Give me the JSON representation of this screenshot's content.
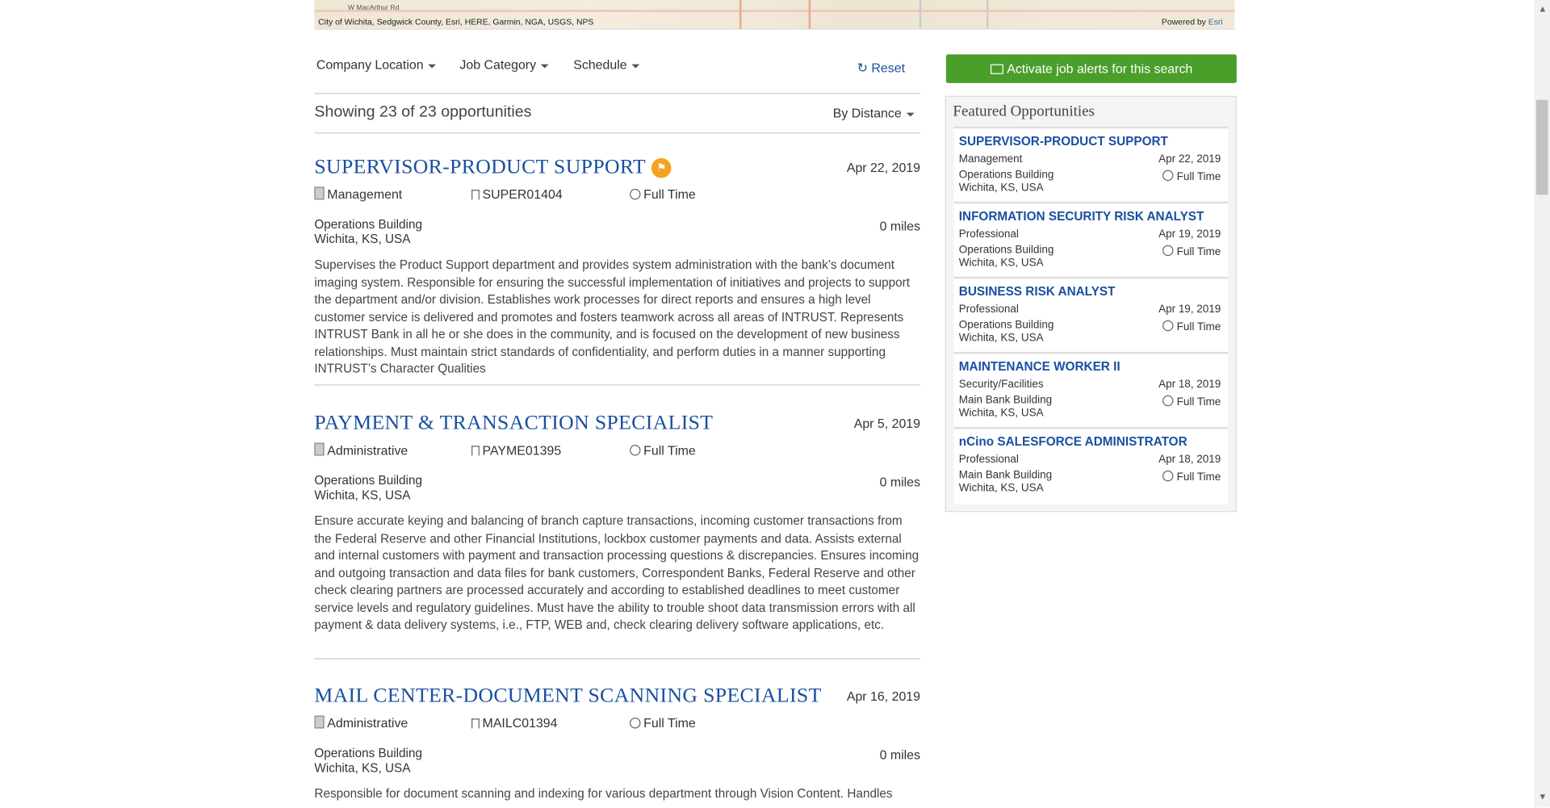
{
  "map": {
    "street_label": "W MacArthur Rd",
    "attribution": "City of Wichita, Sedgwick County, Esri, HERE, Garmin, NGA, USGS, NPS",
    "powered_prefix": "Powered by",
    "powered_brand": "Esri"
  },
  "filters": {
    "location": "Company Location",
    "category": "Job Category",
    "schedule": "Schedule",
    "reset": "Reset"
  },
  "results": {
    "showing": "Showing 23 of 23 opportunities",
    "sort": "By Distance"
  },
  "jobs": [
    {
      "title": "SUPERVISOR-PRODUCT SUPPORT",
      "date": "Apr 22, 2019",
      "category": "Management",
      "code": "SUPER01404",
      "schedule": "Full Time",
      "building": "Operations Building",
      "city": "Wichita, KS, USA",
      "distance": "0 miles",
      "description": "Supervises the Product Support department and provides system administration with the bank’s document imaging system. Responsible for ensuring the successful implementation of initiatives and projects to support the department and/or division. Establishes work processes for direct reports and ensures a high level customer service is delivered and promotes and fosters teamwork across all areas of INTRUST. Represents INTRUST Bank in all he or she does in the community, and is focused on the development of new business relationships. Must maintain strict standards of confidentiality, and perform duties in a manner supporting INTRUST’s Character Qualities"
    },
    {
      "title": "PAYMENT & TRANSACTION SPECIALIST",
      "date": "Apr 5, 2019",
      "category": "Administrative",
      "code": "PAYME01395",
      "schedule": "Full Time",
      "building": "Operations Building",
      "city": "Wichita, KS, USA",
      "distance": "0 miles",
      "description": "Ensure accurate keying and balancing of branch capture transactions, incoming customer transactions from the Federal Reserve and other Financial Institutions, lockbox customer payments and data. Assists external and internal customers with payment and transaction processing questions & discrepancies. Ensures incoming and outgoing transaction and data files for bank customers, Correspondent Banks, Federal Reserve and other check clearing partners are processed accurately and according to established deadlines to meet customer service levels and regulatory guidelines. Must have the ability to trouble shoot data transmission errors with all payment & data delivery systems, i.e., FTP, WEB and, check clearing delivery software applications, etc."
    },
    {
      "title": "MAIL CENTER-DOCUMENT SCANNING SPECIALIST",
      "date": "Apr 16, 2019",
      "category": "Administrative",
      "code": "MAILC01394",
      "schedule": "Full Time",
      "building": "Operations Building",
      "city": "Wichita, KS, USA",
      "distance": "0 miles",
      "description": "Responsible for document scanning and indexing for various department through Vision Content. Handles"
    }
  ],
  "sidebar": {
    "alert_button": "Activate job alerts for this search",
    "featured_heading": "Featured Opportunities",
    "featured": [
      {
        "title": "SUPERVISOR-PRODUCT SUPPORT",
        "category": "Management",
        "date": "Apr 22, 2019",
        "building": "Operations Building",
        "city": "Wichita, KS, USA",
        "schedule": "Full Time"
      },
      {
        "title": "INFORMATION SECURITY RISK ANALYST",
        "category": "Professional",
        "date": "Apr 19, 2019",
        "building": "Operations Building",
        "city": "Wichita, KS, USA",
        "schedule": "Full Time"
      },
      {
        "title": "BUSINESS RISK ANALYST",
        "category": "Professional",
        "date": "Apr 19, 2019",
        "building": "Operations Building",
        "city": "Wichita, KS, USA",
        "schedule": "Full Time"
      },
      {
        "title": "MAINTENANCE WORKER II",
        "category": "Security/Facilities",
        "date": "Apr 18, 2019",
        "building": "Main Bank Building",
        "city": "Wichita, KS, USA",
        "schedule": "Full Time"
      },
      {
        "title": "nCino SALESFORCE ADMINISTRATOR",
        "category": "Professional",
        "date": "Apr 18, 2019",
        "building": "Main Bank Building",
        "city": "Wichita, KS, USA",
        "schedule": "Full Time"
      }
    ]
  },
  "colors": {
    "link": "#1a4fa0",
    "alert_green": "#4a9e2a",
    "flag_orange": "#f5a21c"
  }
}
